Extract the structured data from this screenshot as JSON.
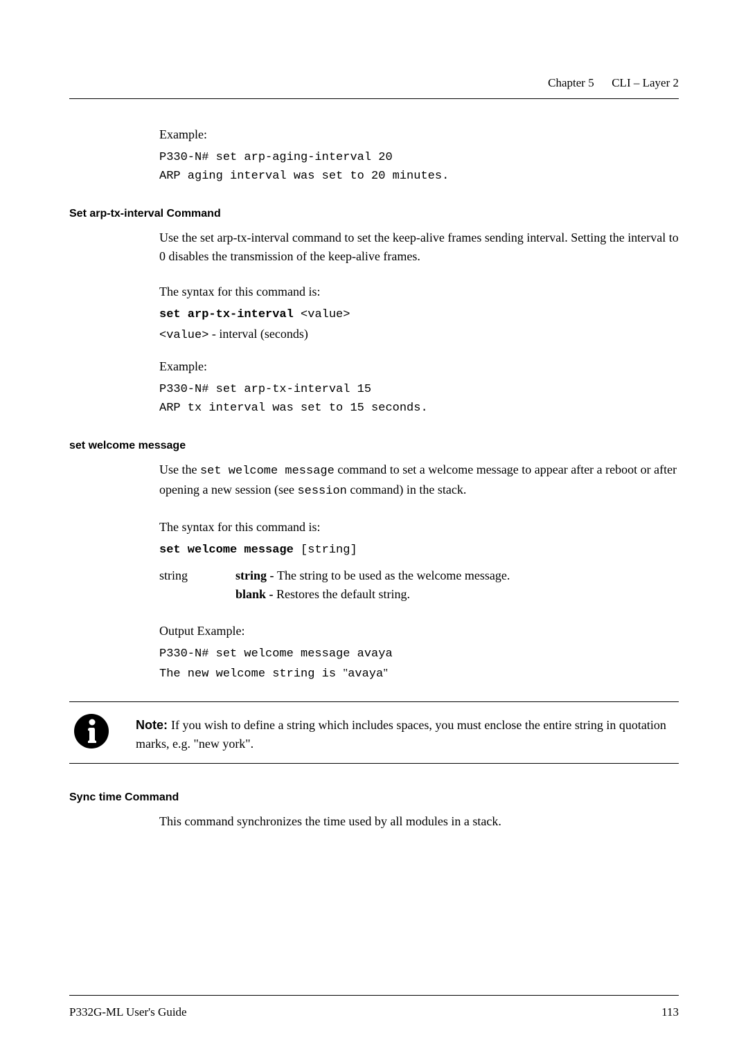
{
  "header": {
    "chapter_label": "Chapter 5",
    "chapter_title": "CLI – Layer 2"
  },
  "block1": {
    "example_label": "Example:",
    "code_line1": "P330-N# set arp-aging-interval 20",
    "code_line2": "ARP aging interval was set to 20 minutes."
  },
  "section1": {
    "heading": "Set arp-tx-interval Command",
    "para": "Use the set arp-tx-interval command to set the keep-alive frames sending interval. Setting the interval to 0 disables the transmission of the keep-alive frames.",
    "syntax_label": "The syntax for this command is:",
    "syntax_cmd_bold": "set arp-tx-interval",
    "syntax_cmd_rest": " <value>",
    "value_desc_code": "<value>",
    "value_desc_rest": " - interval (seconds)",
    "example_label": "Example:",
    "code_line1": "P330-N# set arp-tx-interval 15",
    "code_line2": "ARP tx interval was set to 15 seconds."
  },
  "section2": {
    "heading": "set welcome message",
    "para_pre": "Use the ",
    "para_code1": "set welcome message",
    "para_mid": " command to set a welcome message to appear after a reboot or after opening a new session (see ",
    "para_code2": "session",
    "para_post": " command) in the stack.",
    "syntax_label": "The syntax for this command is:",
    "syntax_cmd_bold": "set welcome message",
    "syntax_cmd_rest": " [string]",
    "def_term": "string",
    "def_bold1": "string - ",
    "def_text1": "The string to be used as the welcome message.",
    "def_bold2": "blank - ",
    "def_text2": "Restores the default string.",
    "output_label": "Output Example:",
    "code_line1": "P330-N# set welcome message avaya",
    "code_line2_pre": "The new welcome string is ",
    "code_line2_quote1": "\"",
    "code_line2_mid": "avaya",
    "code_line2_quote2": "\""
  },
  "note": {
    "label": "Note: ",
    "text": "If you wish to define a string which includes spaces, you must enclose the entire string in quotation marks, e.g. \"new york\"."
  },
  "section3": {
    "heading": "Sync time Command",
    "para": "This command synchronizes the time used by all modules in a stack."
  },
  "footer": {
    "left": "P332G-ML User's Guide",
    "right": "113"
  }
}
